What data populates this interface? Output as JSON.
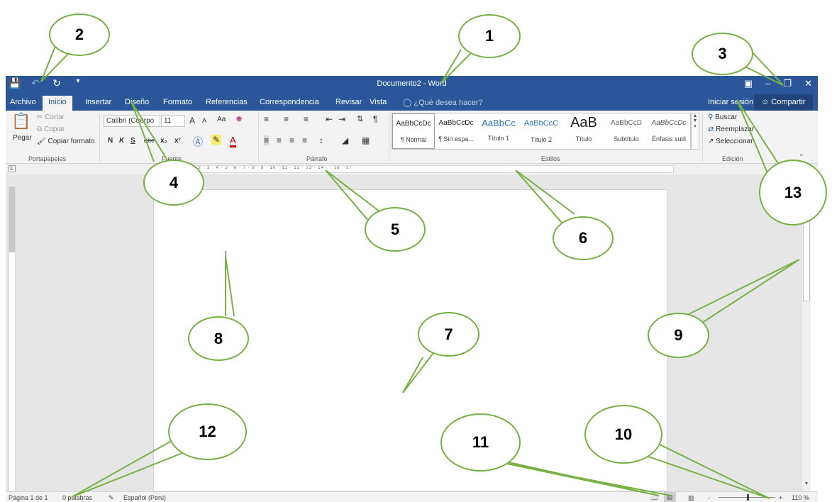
{
  "title_bar": {
    "document_title": "Documento2 - Word",
    "qat_icons": [
      "save-icon",
      "undo-icon",
      "redo-icon",
      "customize-icon"
    ],
    "window_controls": [
      "ribbon-display-icon",
      "minimize-icon",
      "restore-icon",
      "close-icon"
    ]
  },
  "tabs": [
    "Archivo",
    "Inicio",
    "Insertar",
    "Diseño",
    "Formato",
    "Referencias",
    "Correspondencia",
    "Revisar",
    "Vista"
  ],
  "active_tab": "Inicio",
  "tell_me": "¿Qué desea hacer?",
  "account": {
    "signin": "Iniciar sesión",
    "share": "Compartir"
  },
  "ribbon": {
    "clipboard": {
      "paste": "Pegar",
      "cut": "Cortar",
      "copy": "Copiar",
      "format_painter": "Copiar formato",
      "label": "Portapapeles"
    },
    "font": {
      "name": "Calibri (Cuerpo",
      "size": "11",
      "grow": "A",
      "shrink": "A",
      "case": "Aa",
      "bold": "N",
      "italic": "K",
      "underline": "S",
      "strike": "abc",
      "subscript": "x₂",
      "superscript": "x²",
      "label": "Fuente"
    },
    "paragraph": {
      "label": "Párrafo"
    },
    "styles": {
      "label": "Estilos",
      "items": [
        {
          "preview": "AaBbCcDc",
          "name": "¶ Normal"
        },
        {
          "preview": "AaBbCcDc",
          "name": "¶ Sin espa..."
        },
        {
          "preview": "AaBbCc",
          "name": "Título 1"
        },
        {
          "preview": "AaBbCcC",
          "name": "Título 2"
        },
        {
          "preview": "AaB",
          "name": "Título"
        },
        {
          "preview": "AaBbCcD",
          "name": "Subtítulo"
        },
        {
          "preview": "AaBbCcDc",
          "name": "Énfasis sutil"
        }
      ]
    },
    "editing": {
      "find": "Buscar",
      "replace": "Reemplazar",
      "select": "Seleccionar",
      "label": "Edición"
    }
  },
  "ruler": {
    "scale": "3 · 2 · 1 · · 1 · 2 · 3 · 4 · 5 · 6 · 7 · 8 · 9 · 10 · 11 · 12 · 13 · 14 · · 16 · 17 ·"
  },
  "status": {
    "page": "Página 1 de 1",
    "words": "0 palabras",
    "language": "Español (Perú)",
    "zoom": "110 %",
    "zoom_minus": "-",
    "zoom_plus": "+"
  },
  "callouts": [
    "1",
    "2",
    "3",
    "4",
    "5",
    "6",
    "7",
    "8",
    "9",
    "10",
    "11",
    "12",
    "13"
  ],
  "colors": {
    "word_blue": "#2b579a",
    "callout_border": "#77b043"
  }
}
